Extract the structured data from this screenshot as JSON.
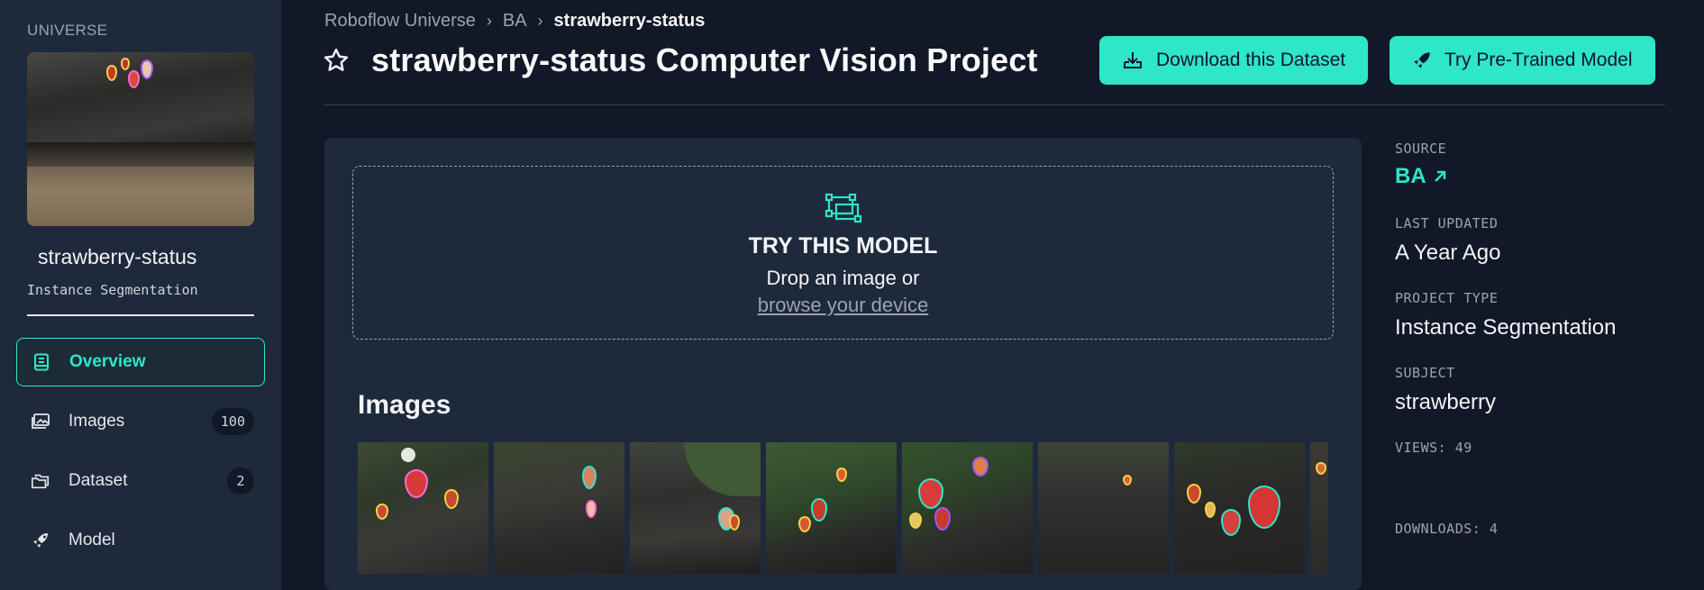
{
  "sidebar": {
    "section_label": "UNIVERSE",
    "project_name": "strawberry-status",
    "project_type": "Instance Segmentation",
    "nav": [
      {
        "label": "Overview",
        "icon": "book-icon",
        "active": true
      },
      {
        "label": "Images",
        "icon": "images-icon",
        "count": "100"
      },
      {
        "label": "Dataset",
        "icon": "folders-icon",
        "count": "2"
      },
      {
        "label": "Model",
        "icon": "rocket-icon"
      }
    ]
  },
  "breadcrumb": {
    "items": [
      "Roboflow Universe",
      "BA",
      "strawberry-status"
    ]
  },
  "header": {
    "title": "strawberry-status Computer Vision Project",
    "download_label": "Download this Dataset",
    "try_model_label": "Try Pre-Trained Model"
  },
  "dropzone": {
    "title": "TRY THIS MODEL",
    "line": "Drop an image or",
    "link": "browse your device"
  },
  "images_section": {
    "title": "Images"
  },
  "meta": {
    "source_label": "SOURCE",
    "source_value": "BA",
    "updated_label": "LAST UPDATED",
    "updated_value": "A Year Ago",
    "type_label": "PROJECT TYPE",
    "type_value": "Instance Segmentation",
    "subject_label": "SUBJECT",
    "subject_value": "strawberry",
    "views": "VIEWS: 49",
    "downloads": "DOWNLOADS: 4"
  },
  "colors": {
    "accent": "#2ee6c8",
    "background": "#111827",
    "panel": "#1e293b"
  }
}
